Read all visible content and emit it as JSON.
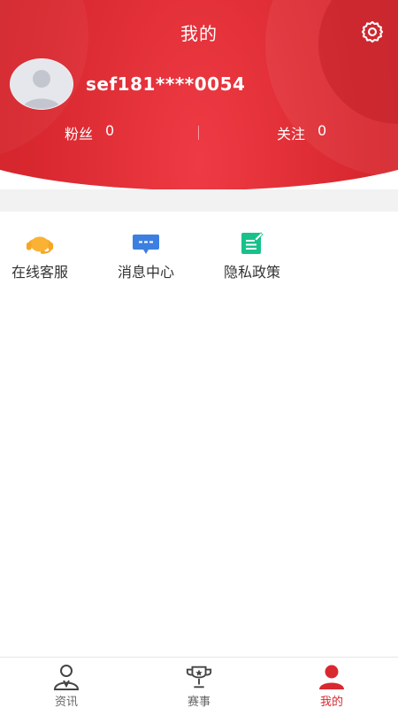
{
  "header": {
    "title": "我的",
    "settings_icon": "gear-icon",
    "background_color": "#d9282f"
  },
  "profile": {
    "username": "sef181****0054",
    "avatar_icon": "default-avatar-icon"
  },
  "stats": {
    "fans_label": "粉丝",
    "fans_count": "0",
    "follow_label": "关注",
    "follow_count": "0"
  },
  "menu": {
    "items": [
      {
        "label": "在线客服",
        "icon": "headset-icon",
        "color": "#f5a623"
      },
      {
        "label": "消息中心",
        "icon": "message-icon",
        "color": "#3d7fe0"
      },
      {
        "label": "隐私政策",
        "icon": "document-icon",
        "color": "#16c28a"
      }
    ]
  },
  "bottom_nav": {
    "items": [
      {
        "label": "资讯",
        "icon": "news-person-icon",
        "active": false
      },
      {
        "label": "赛事",
        "icon": "trophy-icon",
        "active": false
      },
      {
        "label": "我的",
        "icon": "user-icon",
        "active": true
      }
    ],
    "active_color": "#d9282f"
  }
}
